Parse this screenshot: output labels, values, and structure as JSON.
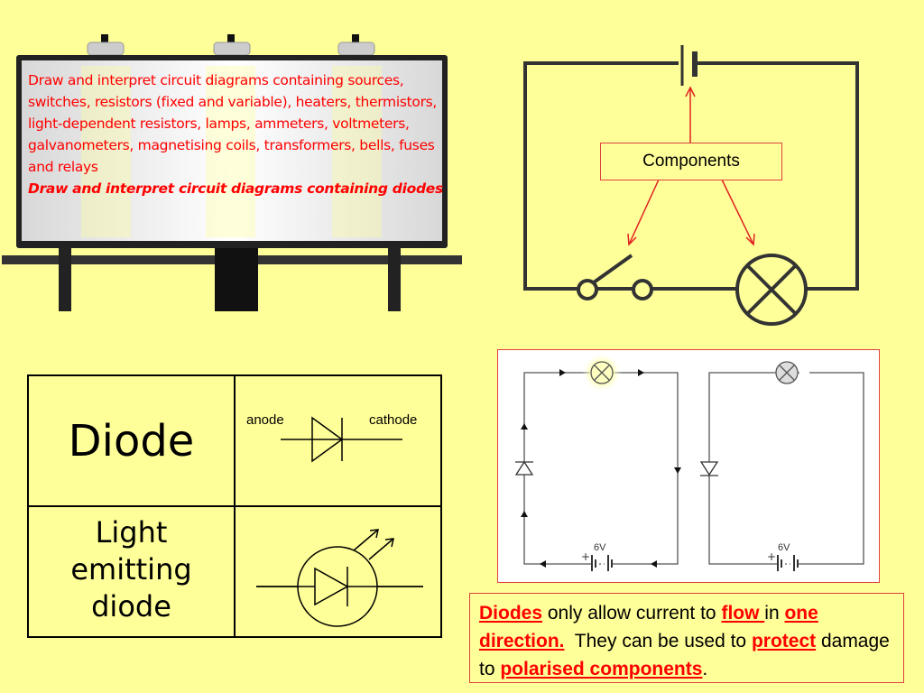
{
  "objectives": {
    "line1": "Draw and interpret circuit diagrams containing sources, switches, resistors (fixed and variable), heaters, thermistors, light-dependent resistors, lamps, ammeters, voltmeters, galvanometers, magnetising coils, transformers, bells, fuses and relays",
    "line2": "Draw and interpret circuit diagrams containing diodes"
  },
  "components_label": "Components",
  "table": {
    "rows": [
      {
        "name": "Diode",
        "anode": "anode",
        "cathode": "cathode"
      },
      {
        "name": "Light emitting diode"
      }
    ]
  },
  "circuits": {
    "left_voltage": "6V",
    "right_voltage": "6V",
    "plus": "+"
  },
  "note": {
    "w1": "Diodes",
    "t1": " only allow current to ",
    "w2": "flow ",
    "t2": "in ",
    "w3": "one direction.",
    "t3": "  They can be used to ",
    "w4": "protect",
    "t4": " damage to ",
    "w5": "polarised components",
    "t5": "."
  },
  "colors": {
    "background": "#ffff99",
    "accent": "#ff0000"
  }
}
